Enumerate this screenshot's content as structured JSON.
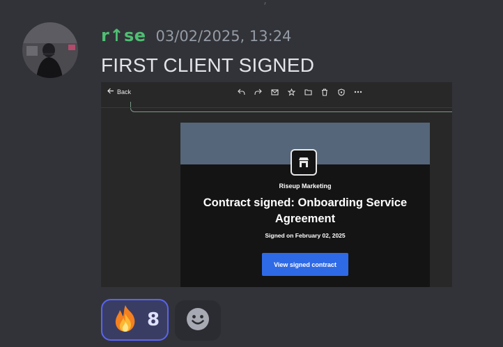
{
  "message": {
    "username": "r↑se",
    "timestamp": "03/02/2025, 13:24",
    "text": "FIRST CLIENT SIGNED"
  },
  "attachment": {
    "toolbar": {
      "back_label": "Back",
      "icons": [
        "reply-icon",
        "forward-icon",
        "mark-read-icon",
        "star-icon",
        "folder-icon",
        "trash-icon",
        "spam-icon",
        "more-icon"
      ]
    },
    "email": {
      "company": "Riseup Marketing",
      "title": "Contract signed: Onboarding Service Agreement",
      "signed_on": "Signed on February 02, 2025",
      "button_label": "View signed contract"
    }
  },
  "reactions": [
    {
      "emoji": "🔥",
      "count": "8",
      "active": true
    }
  ],
  "colors": {
    "background": "#323339",
    "username": "#4fbf73",
    "accent": "#5865f2",
    "email_button": "#2f6ae6",
    "email_banner": "#55667a"
  }
}
